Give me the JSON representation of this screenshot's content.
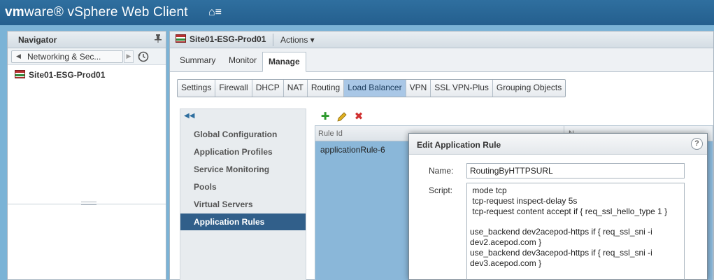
{
  "app": {
    "brand_vm": "vm",
    "brand_rest": "ware® vSphere Web Client",
    "home_glyph": "⌂≡"
  },
  "navigator": {
    "title": "Navigator",
    "breadcrumb": "Networking & Sec...",
    "tree_item": "Site01-ESG-Prod01"
  },
  "main": {
    "title": "Site01-ESG-Prod01",
    "actions_label": "Actions ▾",
    "tabs": [
      {
        "label": "Summary"
      },
      {
        "label": "Monitor"
      },
      {
        "label": "Manage"
      }
    ],
    "subtabs": [
      {
        "label": "Settings"
      },
      {
        "label": "Firewall"
      },
      {
        "label": "DHCP"
      },
      {
        "label": "NAT"
      },
      {
        "label": "Routing"
      },
      {
        "label": "Load Balancer"
      },
      {
        "label": "VPN"
      },
      {
        "label": "SSL VPN-Plus"
      },
      {
        "label": "Grouping Objects"
      }
    ],
    "active_subtab": "Load Balancer"
  },
  "lb_menu": {
    "items": [
      {
        "label": "Global Configuration"
      },
      {
        "label": "Application Profiles"
      },
      {
        "label": "Service Monitoring"
      },
      {
        "label": "Pools"
      },
      {
        "label": "Virtual Servers"
      },
      {
        "label": "Application Rules"
      }
    ],
    "active": "Application Rules"
  },
  "grid": {
    "column_rule_id": "Rule Id",
    "column_2": "N",
    "rows": [
      {
        "rule_id": "applicationRule-6"
      }
    ]
  },
  "dialog": {
    "title": "Edit Application Rule",
    "name_label": "Name:",
    "name_value": "RoutingByHTTPSURL",
    "script_label": "Script:",
    "script_value": " mode tcp\n tcp-request inspect-delay 5s\n tcp-request content accept if { req_ssl_hello_type 1 }\n\nuse_backend dev2acepod-https if { req_ssl_sni -i dev2.acepod.com }\nuse_backend dev3acepod-https if { req_ssl_sni -i dev3.acepod.com }"
  },
  "colors": {
    "header_blue": "#2f6f9f",
    "active_subtab": "#a9c7e6",
    "active_menu": "#315f8a",
    "add_green": "#2e9a2e",
    "edit_yellow": "#d9a21b",
    "delete_red": "#d03030"
  }
}
